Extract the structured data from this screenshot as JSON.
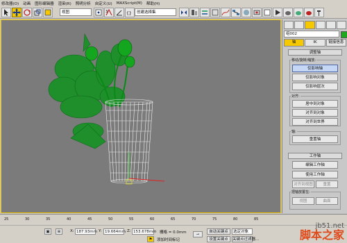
{
  "menu": [
    "修改器(O)",
    "动画",
    "图形编辑器",
    "渲染(R)",
    "照明分析",
    "自定义(U)",
    "MAXScript(M)",
    "帮助(H)"
  ],
  "toolbar": {
    "view_select": "视图",
    "selection_set": "创建选择集"
  },
  "panel": {
    "object_name": "组002",
    "object_color": "#1fa81f",
    "subtabs": [
      "轴",
      "IK",
      "链接信息"
    ],
    "adjust_pivot": {
      "title": "调整轴",
      "move_group_label": "移动/旋转/缩放:",
      "affect_pivot_only": "仅影响轴",
      "affect_object_only": "仅影响对象",
      "affect_hierarchy_only": "仅影响层次",
      "align_label": "对齐:",
      "center_to_object": "居中到对象",
      "align_to_object": "对齐到对象",
      "align_to_world": "对齐到世界",
      "pivot_label": "轴:",
      "reset_pivot": "重置轴"
    },
    "working_pivot": {
      "title": "工作轴",
      "edit_working_pivot": "编辑工作轴",
      "use_working_pivot": "使用工作轴",
      "align_to_view": "对齐到视图",
      "reset": "重置",
      "place_pivot_to": "把轴放置在:",
      "view": "视图",
      "surface": "曲面"
    }
  },
  "timeline": {
    "ticks": [
      "25",
      "30",
      "35",
      "40",
      "45",
      "50",
      "55",
      "60",
      "65",
      "70",
      "75",
      "80",
      "85"
    ]
  },
  "status": {
    "x_label": "X:",
    "x_value": "187.93mm",
    "y_label": "Y:",
    "y_value": "19.664mm",
    "z_label": "Z:",
    "z_value": "153.678mm",
    "grid": "栅格 = 0.0mm",
    "auto_key": "自动关键点",
    "set_key": "设置关键点",
    "selected_object": "选定对象",
    "key_filters": "关键点过滤器...",
    "add_time_tag": "添加时间标记"
  },
  "watermark": {
    "site": "jb51.net",
    "name": "脚本之家"
  }
}
